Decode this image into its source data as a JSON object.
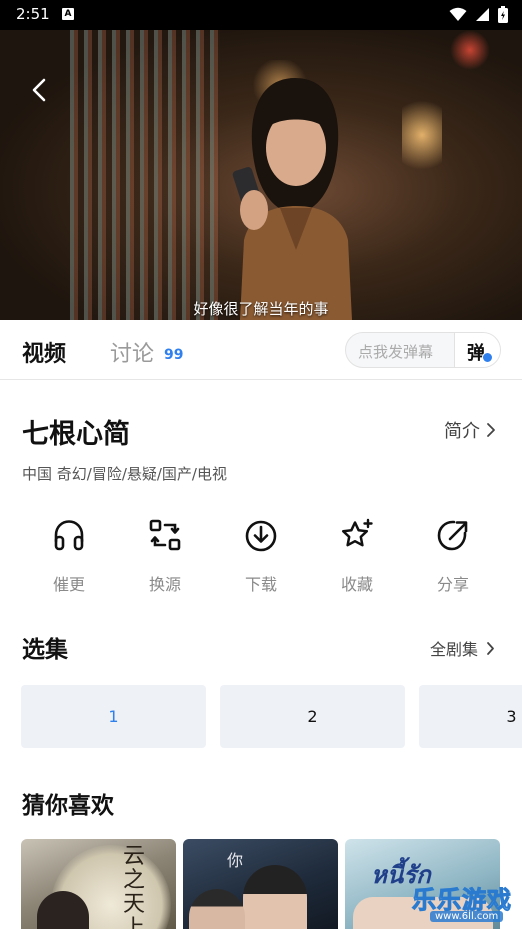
{
  "status_bar": {
    "time": "2:51",
    "notification_letter": "A"
  },
  "player": {
    "subtitle": "好像很了解当年的事"
  },
  "tabs": {
    "video": "视频",
    "discuss": "讨论",
    "discuss_count": "99"
  },
  "danmaku": {
    "placeholder": "点我发弹幕",
    "button_label": "弹"
  },
  "show": {
    "title": "七根心简",
    "intro_label": "简介",
    "meta": "中国  奇幻/冒险/悬疑/国产/电视"
  },
  "actions": [
    {
      "label": "催更",
      "icon": "headphones-icon"
    },
    {
      "label": "换源",
      "icon": "switch-source-icon"
    },
    {
      "label": "下载",
      "icon": "download-icon"
    },
    {
      "label": "收藏",
      "icon": "star-icon"
    },
    {
      "label": "分享",
      "icon": "share-icon"
    }
  ],
  "episodes": {
    "header": "选集",
    "all_label": "全剧集",
    "items": [
      "1",
      "2",
      "3"
    ],
    "active": "1"
  },
  "recommend": {
    "header": "猜你喜欢",
    "posters": [
      {
        "title_text": "云之天上"
      },
      {
        "title_text": "你"
      },
      {
        "title_text": "หนี้รัก"
      }
    ]
  },
  "watermark": {
    "title": "乐乐游戏",
    "url": "www.6ll.com"
  },
  "colors": {
    "accent": "#2f80ed",
    "text": "#111111",
    "muted": "#8a8a8a",
    "episode_bg": "#eef1f6"
  }
}
